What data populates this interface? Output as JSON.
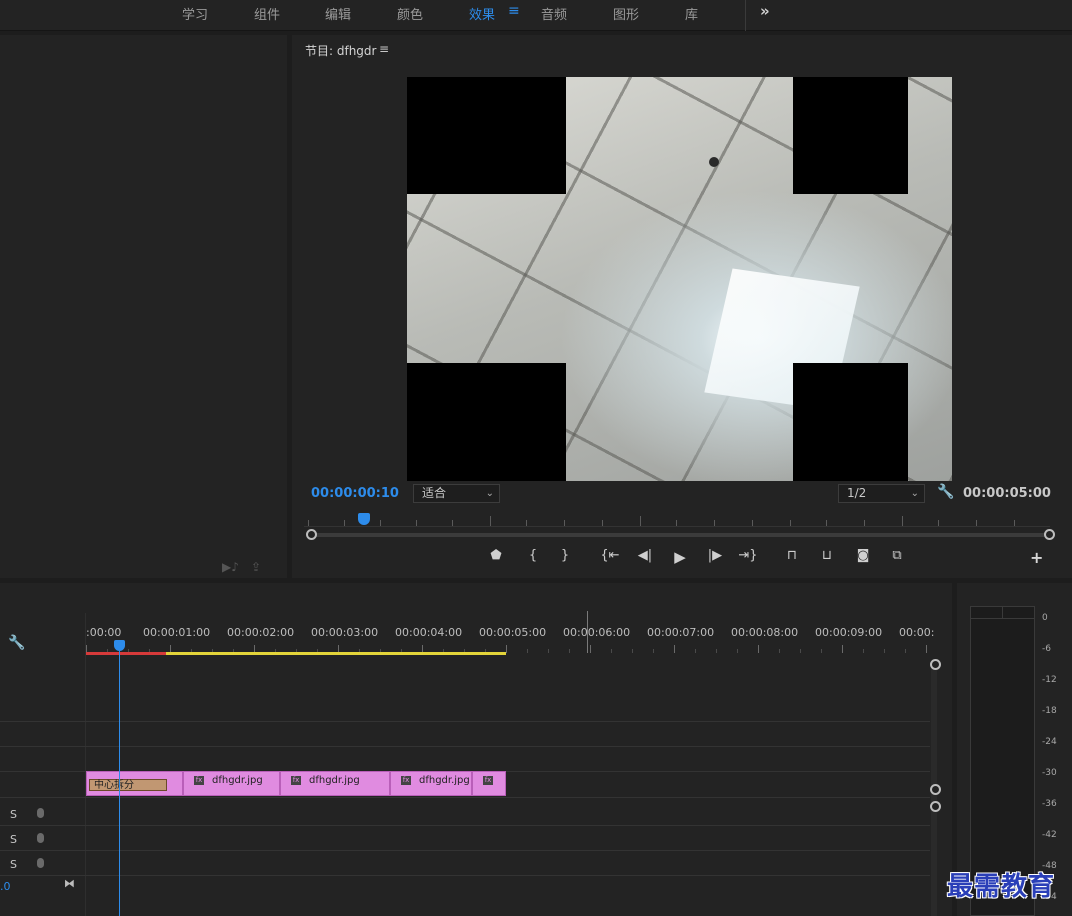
{
  "workspace_tabs": [
    "学习",
    "组件",
    "编辑",
    "颜色",
    "效果",
    "音频",
    "图形",
    "库"
  ],
  "active_tab": "效果",
  "workspace_more": "»",
  "program_monitor": {
    "title": "节目: dfhgdr",
    "menu_icon": "≡",
    "current_timecode": "00:00:00:10",
    "fit_select": "适合",
    "resolution_select": "1/2",
    "duration_timecode": "00:00:05:00",
    "add_button": "+"
  },
  "transport_icons": [
    "add-marker-icon",
    "mark-in-icon",
    "mark-out-icon",
    "go-to-in-icon",
    "step-back-icon",
    "play-icon",
    "step-forward-icon",
    "go-to-out-icon",
    "lift-icon",
    "extract-icon",
    "export-frame-icon",
    "compare-icon"
  ],
  "timeline": {
    "ruler_labels": [
      ":00:00",
      "00:00:01:00",
      "00:00:02:00",
      "00:00:03:00",
      "00:00:04:00",
      "00:00:05:00",
      "00:00:06:00",
      "00:00:07:00",
      "00:00:08:00",
      "00:00:09:00",
      "00:00:"
    ],
    "audio_tracks": [
      {
        "solo": "S"
      },
      {
        "solo": "S"
      },
      {
        "solo": "S"
      }
    ],
    "master_value": ".0",
    "clips": [
      {
        "label": "中心拆分",
        "kind": "transition"
      },
      {
        "label": "dfhgdr.jpg",
        "kind": "image"
      },
      {
        "label": "dfhgdr.jpg",
        "kind": "image"
      },
      {
        "label": "dfhgdr.jpg",
        "kind": "image"
      },
      {
        "label": "",
        "kind": "image"
      }
    ]
  },
  "audio_meter": {
    "scale_labels": [
      "0",
      "-6",
      "-12",
      "-18",
      "-24",
      "-30",
      "-36",
      "-42",
      "-48",
      "-54"
    ]
  },
  "watermark": "最需教育",
  "colors": {
    "accent": "#2d8ceb",
    "clip": "#e08be0",
    "in_out_bar": "#e3d43a",
    "render_red": "#d63a3a"
  }
}
